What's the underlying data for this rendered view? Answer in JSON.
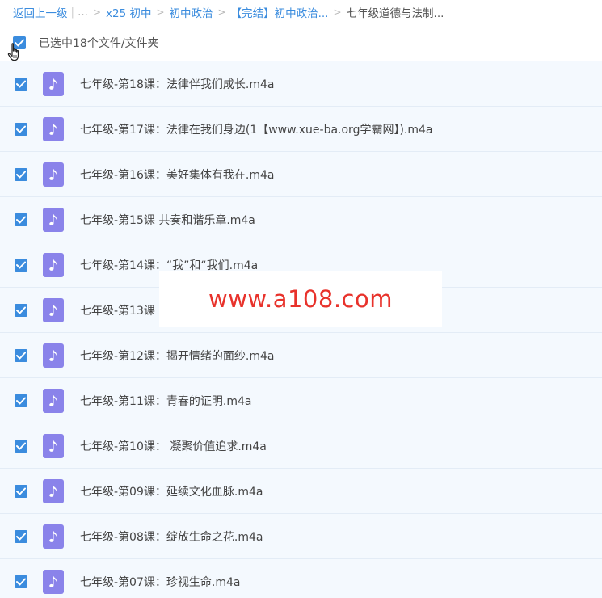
{
  "breadcrumb": {
    "back": "返回上一级",
    "pipe": "|",
    "ellipsis": "...",
    "sep": ">",
    "items": [
      "x25 初中",
      "初中政治",
      "【完结】初中政治..."
    ],
    "current": "七年级道德与法制..."
  },
  "selection": {
    "label": "已选中18个文件/文件夹"
  },
  "files": [
    {
      "name": "七年级-第18课：法律伴我们成长.m4a"
    },
    {
      "name": "七年级-第17课：法律在我们身边(1【www.xue-ba.org学霸网】).m4a"
    },
    {
      "name": "七年级-第16课：美好集体有我在.m4a"
    },
    {
      "name": "七年级-第15课 共奏和谐乐章.m4a"
    },
    {
      "name": "七年级-第14课：“我”和“我们.m4a"
    },
    {
      "name": "七年级-第13课"
    },
    {
      "name": "七年级-第12课：揭开情绪的面纱.m4a"
    },
    {
      "name": "七年级-第11课：青春的证明.m4a"
    },
    {
      "name": "七年级-第10课： 凝聚价值追求.m4a"
    },
    {
      "name": "七年级-第09课：延续文化血脉.m4a"
    },
    {
      "name": "七年级-第08课：绽放生命之花.m4a"
    },
    {
      "name": "七年级-第07课：珍视生命.m4a"
    }
  ],
  "watermark": "www.a108.com",
  "icons": {
    "checkbox": "check-icon",
    "file": "music-note-icon",
    "cursor": "hand-pointer-icon"
  },
  "colors": {
    "accent": "#3b8cde",
    "file_icon": "#8a83ea",
    "row_bg": "#f4f9fe",
    "watermark": "#e8322b"
  }
}
